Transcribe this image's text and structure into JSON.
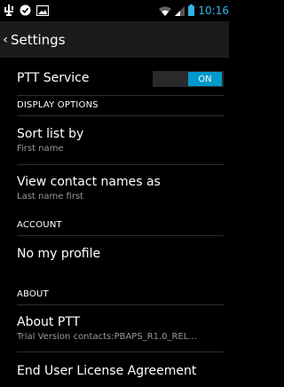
{
  "status_bar": {
    "time": "10:16",
    "icons": [
      "usb-icon",
      "sync-icon",
      "image-icon",
      "wifi-icon",
      "signal-icon",
      "battery-icon"
    ]
  },
  "action_bar": {
    "title": "Settings"
  },
  "ptt_service": {
    "label": "PTT Service",
    "toggle": "ON"
  },
  "display_options": {
    "header": "DISPLAY OPTIONS",
    "sort_list": {
      "title": "Sort list by",
      "summary": "First name"
    },
    "view_names": {
      "title": "View contact names as",
      "summary": "Last name first"
    }
  },
  "account": {
    "header": "ACCOUNT",
    "profile": "No my profile"
  },
  "about": {
    "header": "ABOUT",
    "about_ptt": {
      "title": "About PTT",
      "summary": "Trial Version contacts:PBAPS_R1.0_REL..."
    },
    "eula": "End User License Agreement"
  },
  "colors": {
    "accent": "#33b5e5",
    "toggle_on": "#0099cc",
    "actionbar": "#1b1b1b"
  }
}
